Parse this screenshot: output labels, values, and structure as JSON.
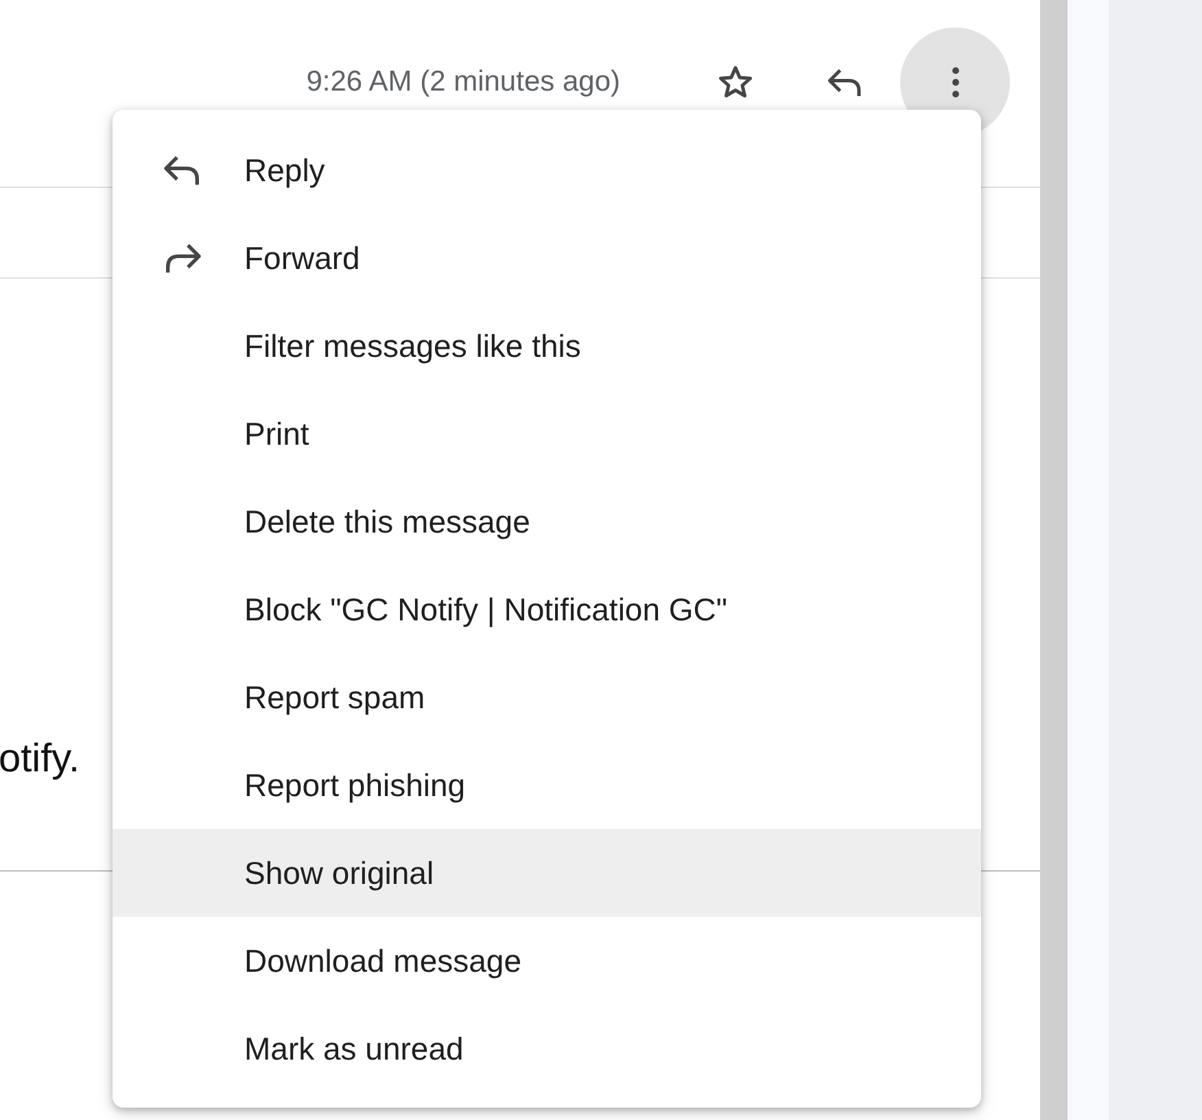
{
  "message_header": {
    "time": "9:26 AM (2 minutes ago)",
    "starred": false
  },
  "body": {
    "lines": [
      "otify."
    ]
  },
  "more_menu": {
    "open": true,
    "items": [
      {
        "label": "Reply",
        "kind": "reply",
        "highlighted": false
      },
      {
        "label": "Forward",
        "kind": "forward",
        "highlighted": false
      },
      {
        "label": "Filter messages like this",
        "highlighted": false
      },
      {
        "label": "Print",
        "highlighted": false
      },
      {
        "label": "Delete this message",
        "highlighted": false
      },
      {
        "label": "Block \"GC Notify | Notification GC\"",
        "highlighted": false
      },
      {
        "label": "Report spam",
        "highlighted": false
      },
      {
        "label": "Report phishing",
        "highlighted": false
      },
      {
        "label": "Show original",
        "highlighted": true
      },
      {
        "label": "Download message",
        "highlighted": false
      },
      {
        "label": "Mark as unread",
        "highlighted": false
      }
    ]
  }
}
